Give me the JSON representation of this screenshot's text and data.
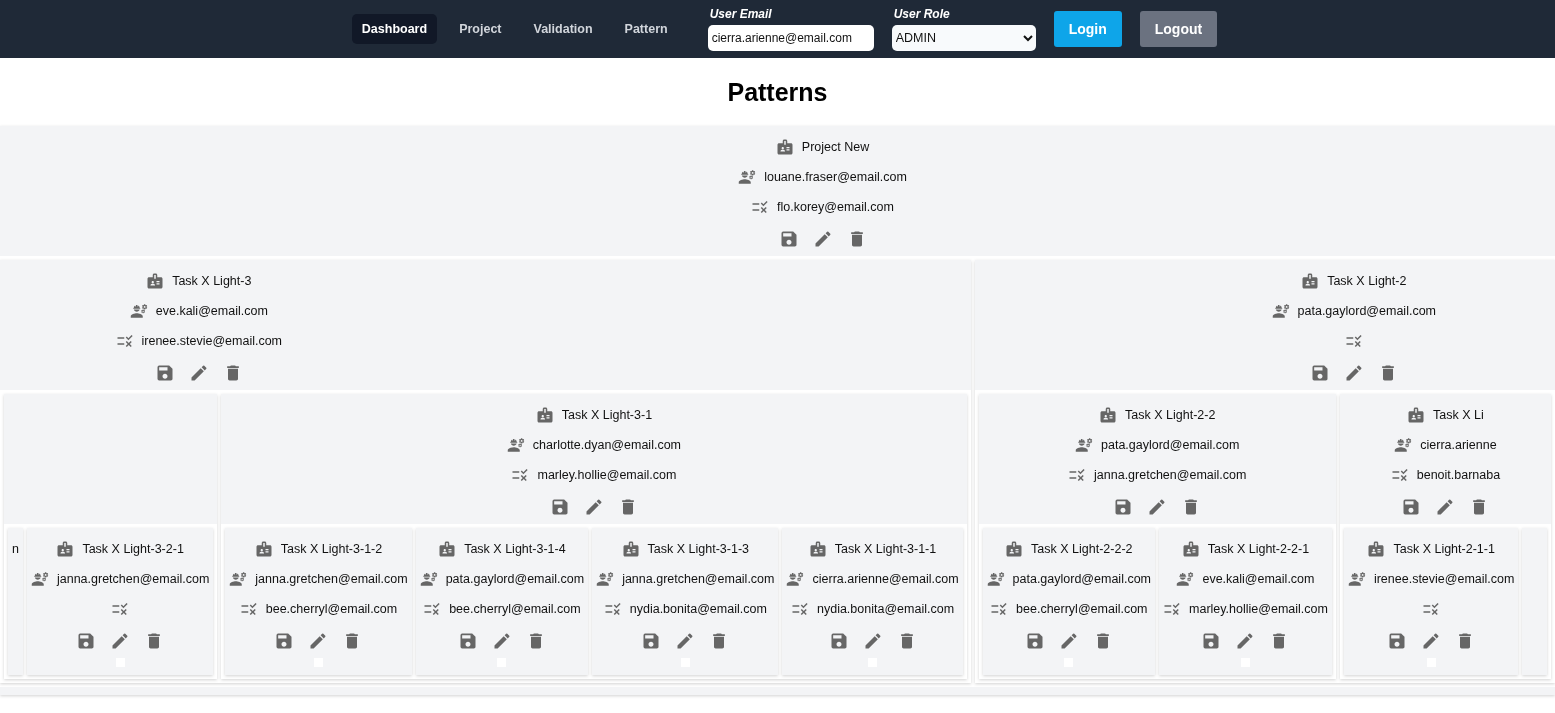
{
  "nav": {
    "links": [
      {
        "label": "Dashboard",
        "selected": true
      },
      {
        "label": "Project",
        "selected": false
      },
      {
        "label": "Validation",
        "selected": false
      },
      {
        "label": "Pattern",
        "selected": false
      }
    ]
  },
  "login": {
    "email_label": "User Email",
    "email": "cierra.arienne@email.com",
    "role_label": "User Role",
    "role": "ADMIN",
    "buttons": [
      {
        "label": "Login",
        "kind": "primary"
      },
      {
        "label": "Logout",
        "kind": "secondary"
      }
    ]
  },
  "title": "Patterns",
  "tree": {
    "kind": "full",
    "title": "Project New",
    "owner": "louane.fraser@email.com",
    "validator": "flo.korey@email.com",
    "children": [
      {
        "kind": "full",
        "title": "Task X Light-3",
        "owner": "eve.kali@email.com",
        "validator": "irenee.stevie@email.com",
        "children": [
          {
            "kind": "cut",
            "children": [
              {
                "kind": "cut",
                "owner": "n"
              },
              {
                "kind": "full",
                "title": "Task X Light-3-2-1",
                "owner": "janna.gretchen@email.com",
                "checked": false
              }
            ]
          },
          {
            "kind": "full",
            "title": "Task X Light-3-1",
            "owner": "charlotte.dyan@email.com",
            "validator": "marley.hollie@email.com",
            "children": [
              {
                "kind": "full",
                "title": "Task X Light-3-1-2",
                "owner": "janna.gretchen@email.com",
                "validator": "bee.cherryl@email.com",
                "checked": false
              },
              {
                "kind": "full",
                "title": "Task X Light-3-1-4",
                "owner": "pata.gaylord@email.com",
                "validator": "bee.cherryl@email.com",
                "checked": false
              },
              {
                "kind": "full",
                "title": "Task X Light-3-1-3",
                "owner": "janna.gretchen@email.com",
                "validator": "nydia.bonita@email.com",
                "checked": false
              },
              {
                "kind": "full",
                "title": "Task X Light-3-1-1",
                "owner": "cierra.arienne@email.com",
                "validator": "nydia.bonita@email.com",
                "checked": false
              }
            ]
          }
        ]
      },
      {
        "kind": "full",
        "title": "Task X Light-2",
        "owner": "pata.gaylord@email.com",
        "children": [
          {
            "kind": "full",
            "title": "Task X Light-2-2",
            "owner": "pata.gaylord@email.com",
            "validator": "janna.gretchen@email.com",
            "children": [
              {
                "kind": "full",
                "title": "Task X Light-2-2-2",
                "owner": "pata.gaylord@email.com",
                "validator": "bee.cherryl@email.com",
                "checked": false
              },
              {
                "kind": "full",
                "title": "Task X Light-2-2-1",
                "owner": "eve.kali@email.com",
                "validator": "marley.hollie@email.com",
                "checked": false
              }
            ]
          },
          {
            "kind": "full",
            "title": "Task X Li",
            "owner": "cierra.arienne",
            "validator": "benoit.barnaba",
            "children": [
              {
                "kind": "full",
                "title": "Task X Light-2-1-1",
                "owner": "irenee.stevie@email.com",
                "checked": false
              },
              {
                "kind": "cut"
              }
            ]
          }
        ]
      }
    ]
  }
}
